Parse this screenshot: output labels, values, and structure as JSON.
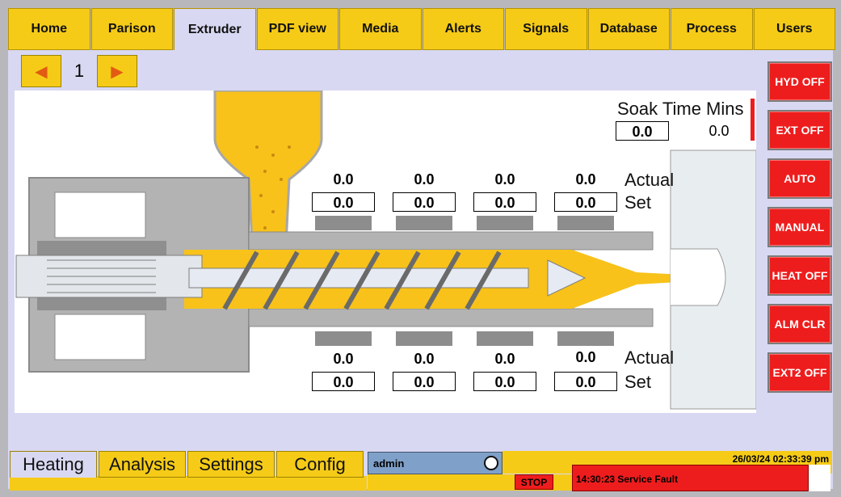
{
  "nav": {
    "tabs": [
      "Home",
      "Parison",
      "Extruder",
      "PDF view",
      "Media",
      "Alerts",
      "Signals",
      "Database",
      "Process",
      "Users"
    ],
    "active": "Extruder"
  },
  "pager": {
    "page": "1"
  },
  "soak": {
    "title": "Soak Time Mins",
    "set": "0.0",
    "actual": "0.0"
  },
  "zones_top": {
    "actual": [
      "0.0",
      "0.0",
      "0.0",
      "0.0"
    ],
    "set": [
      "0.0",
      "0.0",
      "0.0",
      "0.0"
    ],
    "actual_label": "Actual",
    "set_label": "Set"
  },
  "zones_bottom": {
    "actual": [
      "0.0",
      "0.0",
      "0.0",
      "0.0"
    ],
    "set": [
      "0.0",
      "0.0",
      "0.0",
      "0.0"
    ],
    "actual_label": "Actual",
    "set_label": "Set"
  },
  "side_buttons": [
    "HYD OFF",
    "EXT OFF",
    "AUTO",
    "MANUAL",
    "HEAT OFF",
    "ALM CLR",
    "EXT2 OFF"
  ],
  "bottom_tabs": [
    "Heating",
    "Analysis",
    "Settings",
    "Config"
  ],
  "status": {
    "user": "admin",
    "datetime": "26/03/24 02:33:39 pm",
    "stop": "STOP",
    "alarm": "14:30:23 Service Fault"
  },
  "colors": {
    "accent_yellow": "#f5cb18",
    "alarm_red": "#ee1d1d",
    "panel_lavender": "#d8d8f2"
  }
}
